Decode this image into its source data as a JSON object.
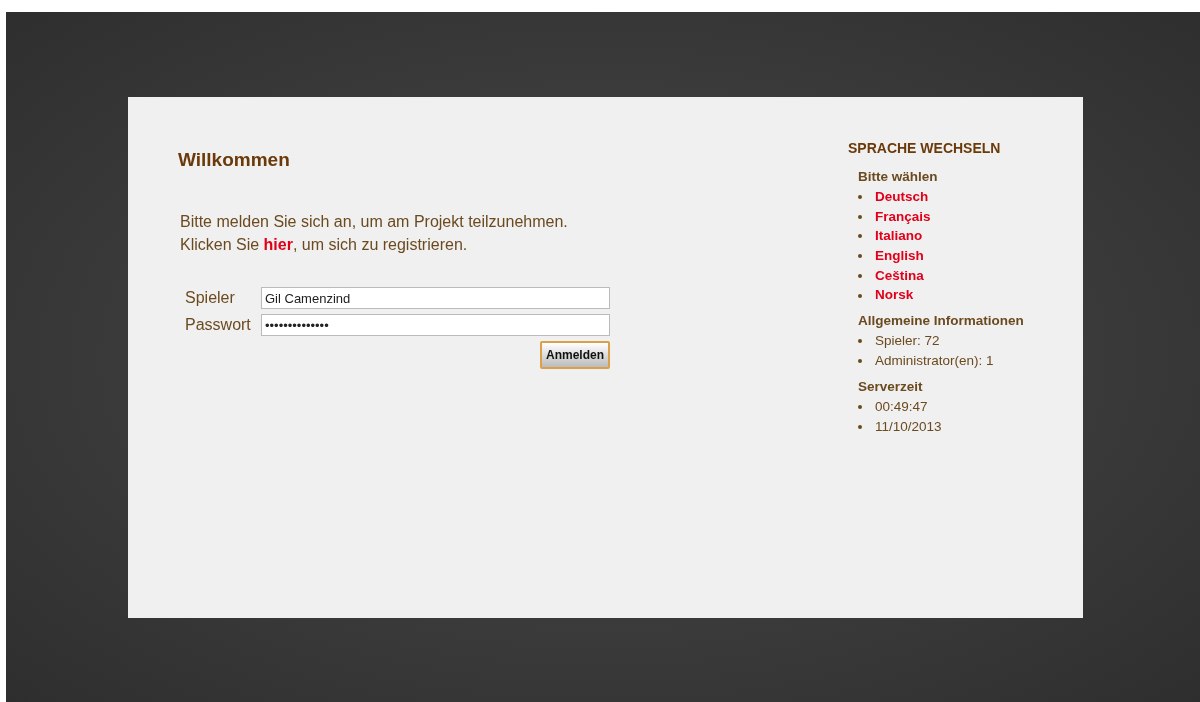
{
  "welcome": {
    "title": "Willkommen",
    "intro": "Bitte melden Sie sich an, um am Projekt teilzunehmen.",
    "register": {
      "before": "Klicken Sie ",
      "link": "hier",
      "after": ", um sich zu registrieren."
    }
  },
  "login": {
    "fields": [
      {
        "label": "Spieler",
        "value": "Gil Camenzind"
      },
      {
        "label": "Passwort",
        "value": "••••••••••••••"
      }
    ],
    "button": "Anmelden"
  },
  "sidebar": {
    "title": "SPRACHE WECHSELN",
    "sections": [
      {
        "heading": "Bitte wählen",
        "kind": "links",
        "items": [
          "Deutsch",
          "Français",
          "Italiano",
          "English",
          "Ceština",
          "Norsk"
        ]
      },
      {
        "heading": "Allgemeine Informationen",
        "kind": "text",
        "items": [
          "Spieler: 72",
          "Administrator(en): 1"
        ]
      },
      {
        "heading": "Serverzeit",
        "kind": "text",
        "items": [
          "00:49:47",
          "11/10/2013"
        ]
      }
    ]
  }
}
